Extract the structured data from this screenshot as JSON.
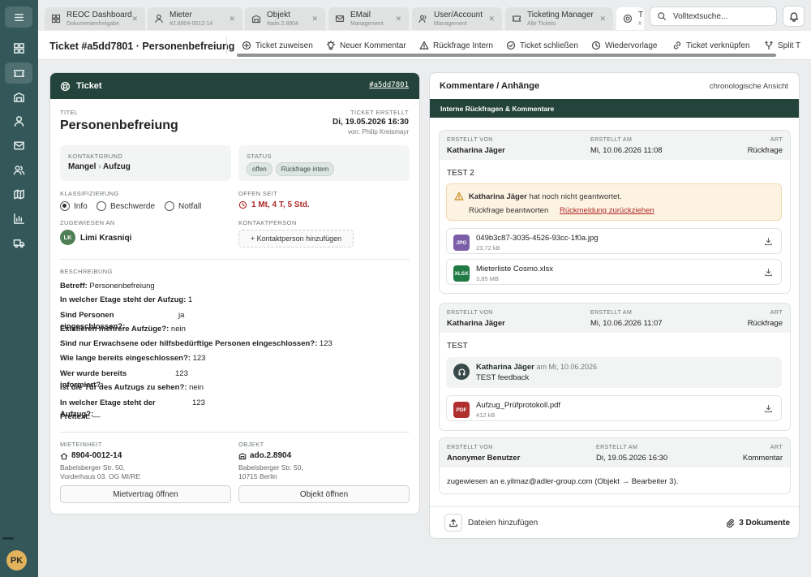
{
  "sidebar": {
    "menu_icon": "menu-icon",
    "items": [
      "dashboard-icon",
      "ticket-icon",
      "building-icon",
      "person-icon",
      "mail-icon",
      "users-icon",
      "map-icon",
      "chart-icon",
      "truck-icon"
    ],
    "avatar": "PK"
  },
  "tabs": [
    {
      "title": "REOC Dashboard",
      "sub": "Dokumentenfreigabe",
      "icon": "dashboard-icon"
    },
    {
      "title": "Mieter",
      "sub": "#2.8904-0012-14",
      "icon": "person-icon"
    },
    {
      "title": "Objekt",
      "sub": "#ado.2.8904",
      "icon": "building-icon"
    },
    {
      "title": "EMail",
      "sub": "Management",
      "icon": "mail-icon"
    },
    {
      "title": "User/Account",
      "sub": "Management",
      "icon": "users-icon"
    },
    {
      "title": "Ticketing Manager",
      "sub": "Alle Tickets",
      "icon": "ticket-icon"
    },
    {
      "title": "T",
      "sub": "#",
      "icon": "lifebuoy-icon"
    }
  ],
  "search": {
    "placeholder": "Volltextsuche..."
  },
  "toolbar": {
    "heading": "Ticket #a5dd7801 · Personenbefreiung",
    "actions": [
      "Ticket zuweisen",
      "Neuer Kommentar",
      "Rückfrage Intern",
      "Ticket schließen",
      "Wiedervorlage",
      "Ticket verknüpfen",
      "Split T"
    ]
  },
  "ticket": {
    "header_label": "Ticket",
    "id": "#a5dd7801",
    "titel_label": "TITEL",
    "titel": "Personenbefreiung",
    "created_label": "TICKET ERSTELLT",
    "created": "Di, 19.05.2026 16:30",
    "created_by": "von: Philip Kreismayr",
    "kontaktgrund_label": "KONTAKTGRUND",
    "kontaktgrund_1": "Mangel",
    "kontaktgrund_sep": "›",
    "kontaktgrund_2": "Aufzug",
    "status_label": "STATUS",
    "status": [
      "offen",
      "Rückfrage intern"
    ],
    "klass_label": "KLASSIFIZIERUNG",
    "klass": [
      "Info",
      "Beschwerde",
      "Notfall"
    ],
    "klass_selected": "Info",
    "offen_label": "OFFEN SEIT",
    "offen": "1 Mt, 4 T, 5 Std.",
    "assigned_label": "ZUGEWIESEN AN",
    "assigned_initials": "LK",
    "assigned": "Limi Krasniqi",
    "contact_label": "KONTAKTPERSON",
    "contact_btn": "+ Kontaktperson hinzufügen",
    "beschreibung_label": "BESCHREIBUNG",
    "desc": [
      {
        "k": "Betreff:",
        "v": "Personenbefreiung"
      },
      {
        "k": "In welcher Etage steht der Aufzug:",
        "v": "1"
      },
      {
        "k": "Sind Personen eingeschlossen?:",
        "v": "ja"
      },
      {
        "k": "Existieren mehrere Aufzüge?:",
        "v": "nein"
      },
      {
        "k": "Sind nur Erwachsene oder hilfsbedürftige Personen eingeschlossen?:",
        "v": "123"
      },
      {
        "k": "Wie lange bereits eingeschlossen?:",
        "v": "123"
      },
      {
        "k": "Wer wurde bereits informiert?:",
        "v": "123"
      },
      {
        "k": "Ist die Tür des Aufzugs zu sehen?:",
        "v": "nein"
      },
      {
        "k": "In welcher Etage steht der Aufzug?:",
        "v": "123"
      },
      {
        "k": "Freitext:",
        "v": "—"
      }
    ],
    "mieteinheit_label": "MIETEINHEIT",
    "mieteinheit": "8904-0012-14",
    "mieteinheit_addr1": "Babelsberger Str. 50,",
    "mieteinheit_addr2": "Vorderhaus 03. OG MI/RE",
    "objekt_label": "OBJEKT",
    "objekt": "ado.2.8904",
    "objekt_addr1": "Babelsberger Str. 50,",
    "objekt_addr2": "10715 Berlin",
    "btn_mietvertrag": "Mietvertrag öffnen",
    "btn_objekt": "Objekt öffnen"
  },
  "comments": {
    "title": "Kommentare / Anhänge",
    "view": "chronologische Ansicht",
    "band": "Interne Rückfragen & Kommentare",
    "lbl_by": "ERSTELLT VON",
    "lbl_at": "ERSTELLT AM",
    "lbl_type": "ART",
    "c1": {
      "by": "Katharina Jäger",
      "at": "Mi, 10.06.2026 11:08",
      "type": "Rückfrage",
      "body": "TEST 2",
      "warn_name": "Katharina Jäger",
      "warn_text": "hat noch nicht geantwortet.",
      "warn_action1": "Rückfrage beantworten",
      "warn_action2": "Rückmeldung zurückziehen",
      "files": [
        {
          "badge": "JPG",
          "name": "049b3c87-3035-4526-93cc-1f0a.jpg",
          "size": "23,72 kB",
          "color": "#7b5ea7"
        },
        {
          "badge": "XLSX",
          "name": "Mieterliste Cosmo.xlsx",
          "size": "3,85 MB",
          "color": "#1f7a44"
        }
      ]
    },
    "c2": {
      "by": "Katharina Jäger",
      "at": "Mi, 10.06.2026 11:07",
      "type": "Rückfrage",
      "body": "TEST",
      "reply_name": "Katharina Jäger",
      "reply_at": "am Mi, 10.06.2026",
      "reply_text": "TEST feedback",
      "files": [
        {
          "badge": "PDF",
          "name": "Aufzug_Prüfprotokoll.pdf",
          "size": "412 kB",
          "color": "#b03030"
        }
      ]
    },
    "c3": {
      "by": "Anonymer Benutzer",
      "at": "Di, 19.05.2026 16:30",
      "type": "Kommentar",
      "body": "zugewiesen an e.yilmaz@adler-group.com (Objekt → Bearbeiter 3)."
    },
    "add_files": "Dateien hinzufügen",
    "doc_count": "3",
    "doc_label": "Dokumente"
  }
}
